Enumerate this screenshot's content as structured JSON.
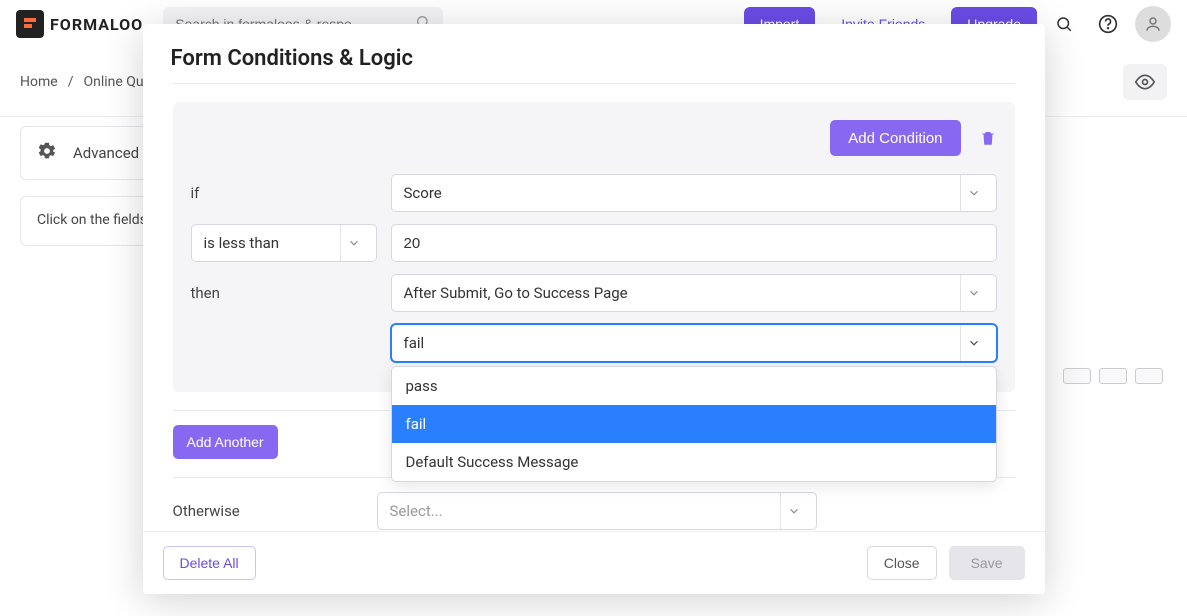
{
  "brand": {
    "name": "FORMALOO"
  },
  "search": {
    "placeholder": "Search in formaloos & respo…"
  },
  "header": {
    "import_label": "Import",
    "invite_label": "Invite Friends",
    "upgrade_label": "Upgrade"
  },
  "breadcrumb": {
    "home": "Home",
    "sep": "/",
    "current": "Online Quiz"
  },
  "sidebar": {
    "advanced_label": "Advanced",
    "tip": "Click on the fields to add logic."
  },
  "modal": {
    "title": "Form Conditions & Logic",
    "add_condition_label": "Add Condition",
    "if_label": "if",
    "field_select_value": "Score",
    "operator_value": "is less than",
    "value_input": "20",
    "then_label": "then",
    "action_select_value": "After Submit, Go to Success Page",
    "target_select_value": "fail",
    "dropdown_options": [
      "pass",
      "fail",
      "Default Success Message"
    ],
    "dropdown_selected_index": 1,
    "add_another_label": "Add Another",
    "otherwise_label": "Otherwise",
    "otherwise_placeholder": "Select..."
  },
  "footer": {
    "delete_all_label": "Delete All",
    "close_label": "Close",
    "save_label": "Save"
  }
}
